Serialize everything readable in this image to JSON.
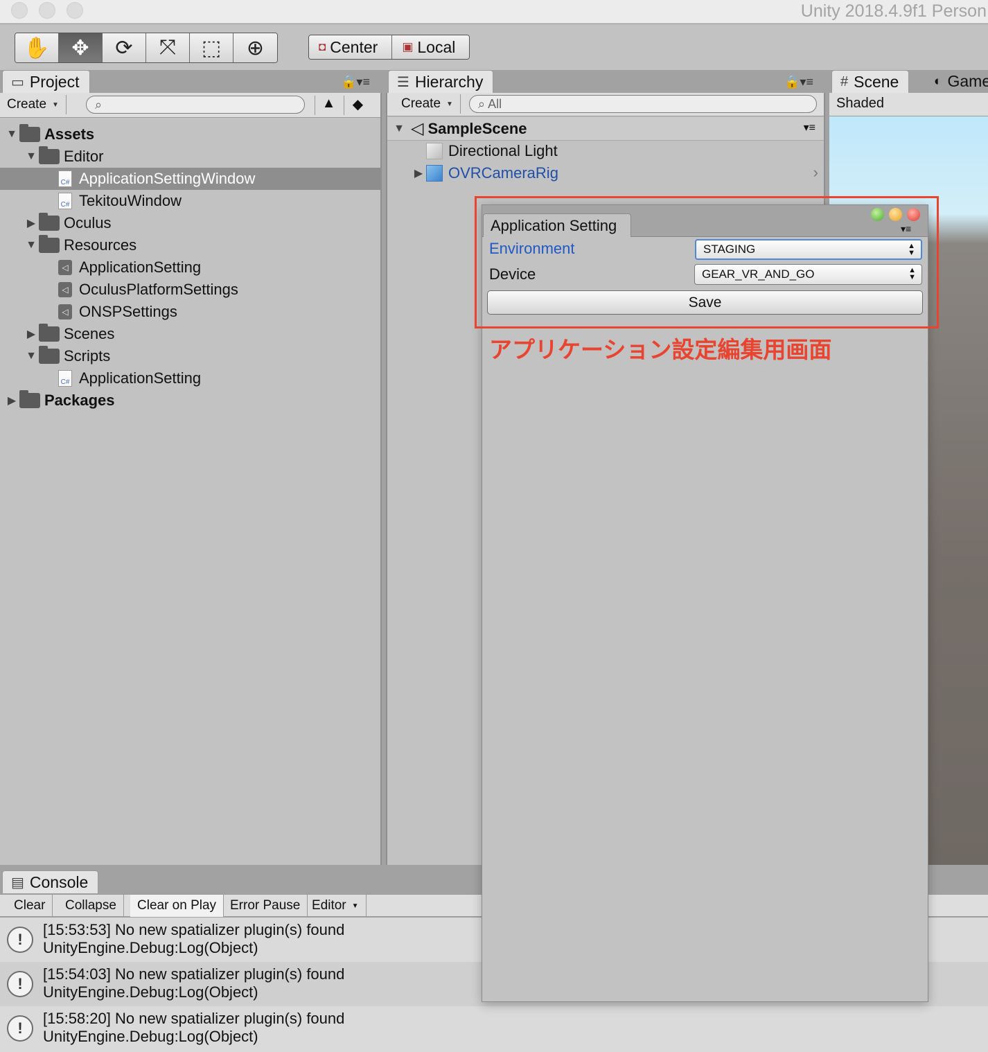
{
  "window": {
    "title": "Unity 2018.4.9f1 Person"
  },
  "toolbar": {
    "tools": [
      {
        "name": "hand-tool",
        "glyph": "✋"
      },
      {
        "name": "move-tool",
        "glyph": "✥"
      },
      {
        "name": "rotate-tool",
        "glyph": "⟳"
      },
      {
        "name": "scale-tool",
        "glyph": "⤧"
      },
      {
        "name": "rect-tool",
        "glyph": "⬚"
      },
      {
        "name": "transform-tool",
        "glyph": "⊕"
      }
    ],
    "pivot": {
      "center_label": "Center",
      "local_label": "Local"
    }
  },
  "project": {
    "tab_label": "Project",
    "create_label": "Create",
    "tree": [
      {
        "label": "Assets",
        "indent": 0,
        "expand": "open",
        "icon": "folder",
        "bold": true
      },
      {
        "label": "Editor",
        "indent": 1,
        "expand": "open",
        "icon": "folder"
      },
      {
        "label": "ApplicationSettingWindow",
        "indent": 2,
        "expand": "none",
        "icon": "cs",
        "selected": true
      },
      {
        "label": "TekitouWindow",
        "indent": 2,
        "expand": "none",
        "icon": "cs"
      },
      {
        "label": "Oculus",
        "indent": 1,
        "expand": "closed",
        "icon": "folder"
      },
      {
        "label": "Resources",
        "indent": 1,
        "expand": "open",
        "icon": "folder"
      },
      {
        "label": "ApplicationSetting",
        "indent": 2,
        "expand": "none",
        "icon": "so"
      },
      {
        "label": "OculusPlatformSettings",
        "indent": 2,
        "expand": "none",
        "icon": "so"
      },
      {
        "label": "ONSPSettings",
        "indent": 2,
        "expand": "none",
        "icon": "so"
      },
      {
        "label": "Scenes",
        "indent": 1,
        "expand": "closed",
        "icon": "folder"
      },
      {
        "label": "Scripts",
        "indent": 1,
        "expand": "open",
        "icon": "folder"
      },
      {
        "label": "ApplicationSetting",
        "indent": 2,
        "expand": "none",
        "icon": "cs"
      },
      {
        "label": "Packages",
        "indent": 0,
        "expand": "closed",
        "icon": "folder",
        "bold": true
      }
    ]
  },
  "hierarchy": {
    "tab_label": "Hierarchy",
    "create_label": "Create",
    "search_placeholder": "All",
    "scene_name": "SampleScene",
    "items": [
      {
        "label": "Directional Light",
        "color": "#111111",
        "cube": "gray",
        "expandable": false
      },
      {
        "label": "OVRCameraRig",
        "color": "#1f4fa8",
        "cube": "blue",
        "expandable": true
      }
    ]
  },
  "scene": {
    "tab_label": "Scene",
    "game_tab_label": "Game",
    "shading_label": "Shaded"
  },
  "console": {
    "tab_label": "Console",
    "buttons": [
      "Clear",
      "Collapse",
      "Clear on Play",
      "Error Pause",
      "Editor"
    ],
    "logs": [
      {
        "line1": "[15:53:53] No new spatializer plugin(s) found",
        "line2": "UnityEngine.Debug:Log(Object)"
      },
      {
        "line1": "[15:54:03] No new spatializer plugin(s) found",
        "line2": "UnityEngine.Debug:Log(Object)"
      },
      {
        "line1": "[15:58:20] No new spatializer plugin(s) found",
        "line2": "UnityEngine.Debug:Log(Object)"
      }
    ]
  },
  "app_setting_window": {
    "tab_label": "Application Setting",
    "environment_label": "Environment",
    "environment_value": "STAGING",
    "device_label": "Device",
    "device_value": "GEAR_VR_AND_GO",
    "save_label": "Save"
  },
  "annotation": {
    "text": "アプリケーション設定編集用画面",
    "color": "#e9442f"
  }
}
